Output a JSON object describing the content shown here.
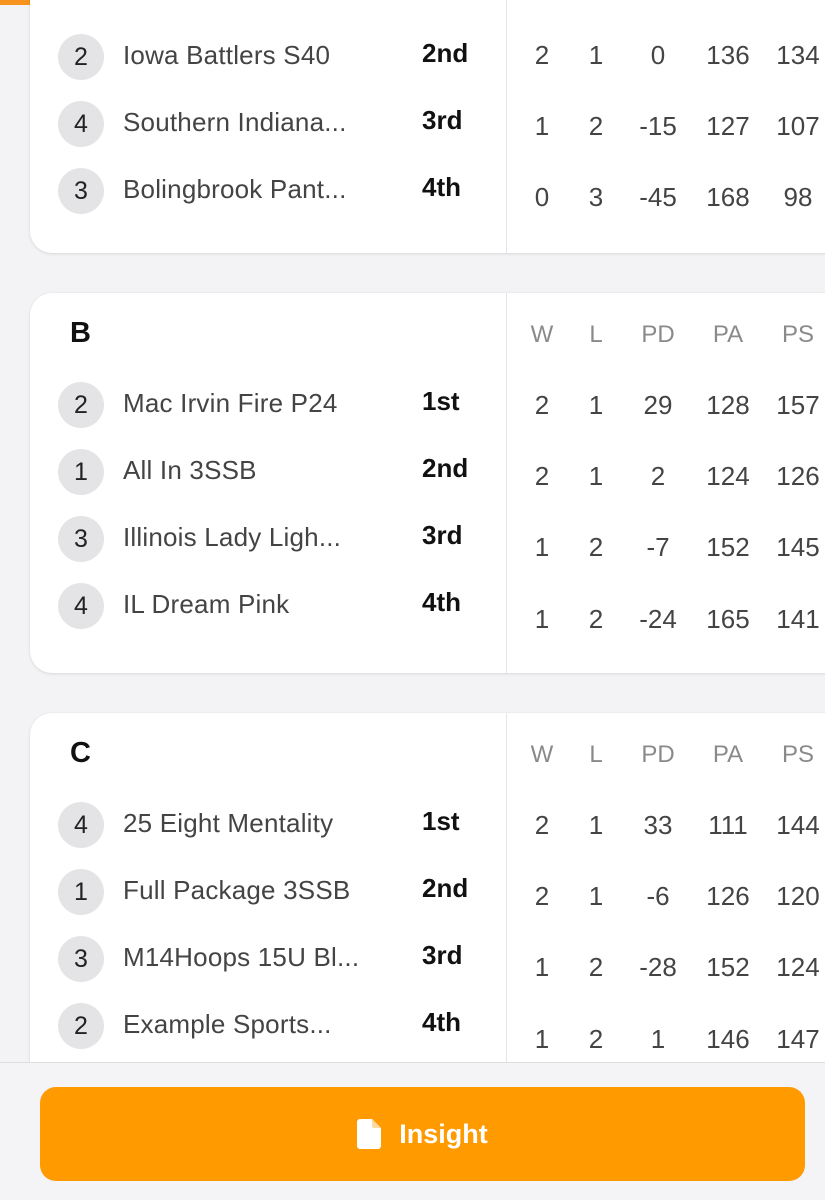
{
  "colors": {
    "accent": "#ff9a00",
    "progress": "#f7941d"
  },
  "stat_headers": [
    "W",
    "L",
    "PD",
    "PA",
    "PS"
  ],
  "groups": [
    {
      "title": "",
      "teams": [
        {
          "seed": "2",
          "name": "Iowa Battlers S40",
          "place": "2nd",
          "stats": [
            "2",
            "1",
            "0",
            "136",
            "134"
          ]
        },
        {
          "seed": "4",
          "name": "Southern Indiana...",
          "place": "3rd",
          "stats": [
            "1",
            "2",
            "-15",
            "127",
            "107"
          ]
        },
        {
          "seed": "3",
          "name": "Bolingbrook Pant...",
          "place": "4th",
          "stats": [
            "0",
            "3",
            "-45",
            "168",
            "98"
          ]
        }
      ]
    },
    {
      "title": "B",
      "teams": [
        {
          "seed": "2",
          "name": "Mac Irvin Fire P24",
          "place": "1st",
          "stats": [
            "2",
            "1",
            "29",
            "128",
            "157"
          ]
        },
        {
          "seed": "1",
          "name": "All In 3SSB",
          "place": "2nd",
          "stats": [
            "2",
            "1",
            "2",
            "124",
            "126"
          ]
        },
        {
          "seed": "3",
          "name": "Illinois Lady Ligh...",
          "place": "3rd",
          "stats": [
            "1",
            "2",
            "-7",
            "152",
            "145"
          ]
        },
        {
          "seed": "4",
          "name": "IL Dream Pink",
          "place": "4th",
          "stats": [
            "1",
            "2",
            "-24",
            "165",
            "141"
          ]
        }
      ]
    },
    {
      "title": "C",
      "teams": [
        {
          "seed": "4",
          "name": "25 Eight Mentality",
          "place": "1st",
          "stats": [
            "2",
            "1",
            "33",
            "111",
            "144"
          ]
        },
        {
          "seed": "1",
          "name": "Full Package 3SSB",
          "place": "2nd",
          "stats": [
            "2",
            "1",
            "-6",
            "126",
            "120"
          ]
        },
        {
          "seed": "3",
          "name": "M14Hoops 15U Bl...",
          "place": "3rd",
          "stats": [
            "1",
            "2",
            "-28",
            "152",
            "124"
          ]
        },
        {
          "seed": "2",
          "name": "Example Sports...",
          "place": "4th",
          "stats": [
            "1",
            "2",
            "1",
            "146",
            "147"
          ]
        }
      ]
    }
  ],
  "footer": {
    "insight_label": "Insight",
    "insight_icon": "document-icon"
  }
}
